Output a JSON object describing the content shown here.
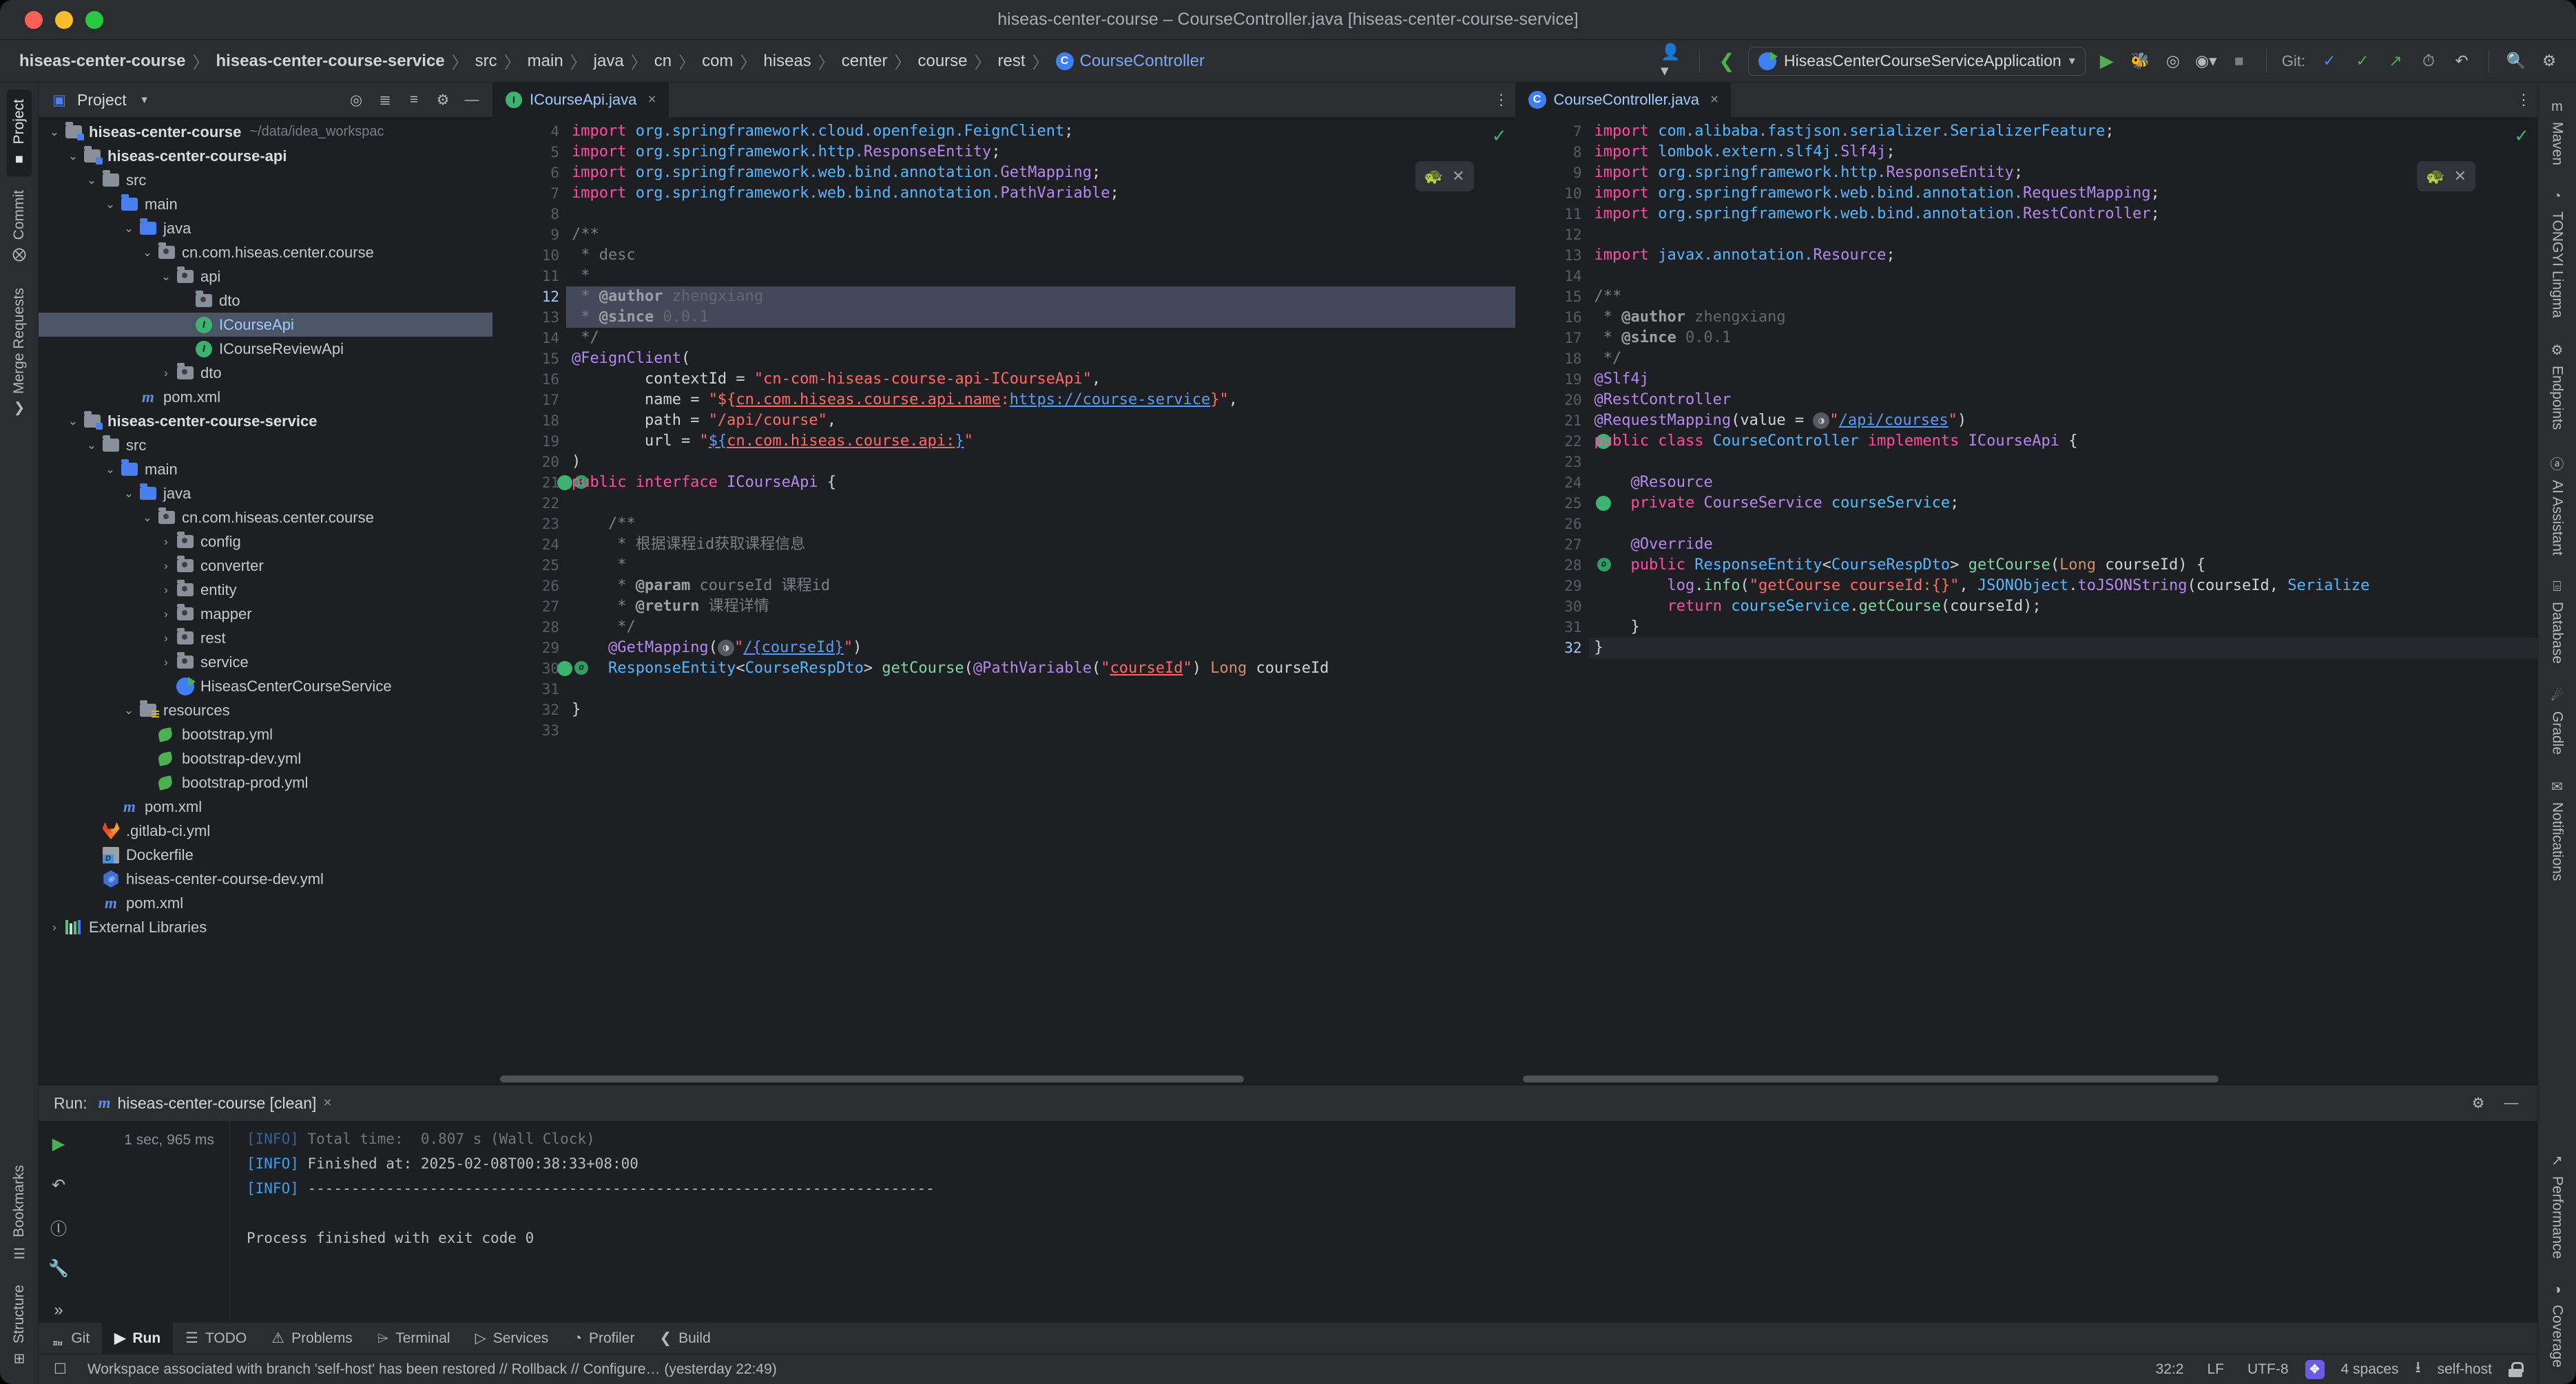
{
  "window": {
    "title": "hiseas-center-course – CourseController.java [hiseas-center-course-service]"
  },
  "breadcrumbs": [
    {
      "label": "hiseas-center-course",
      "bold": true
    },
    {
      "label": "hiseas-center-course-service",
      "bold": true
    },
    {
      "label": "src",
      "bold": false
    },
    {
      "label": "main",
      "bold": false
    },
    {
      "label": "java",
      "bold": false
    },
    {
      "label": "cn",
      "bold": false
    },
    {
      "label": "com",
      "bold": false
    },
    {
      "label": "hiseas",
      "bold": false
    },
    {
      "label": "center",
      "bold": false
    },
    {
      "label": "course",
      "bold": false
    },
    {
      "label": "rest",
      "bold": false
    },
    {
      "label": "CourseController",
      "bold": false,
      "class": true,
      "icon": "C"
    }
  ],
  "toolbar": {
    "run_config": "HiseasCenterCourseServiceApplication",
    "run_config_icon": "spring-boot-icon",
    "git_label": "Git:",
    "icons": [
      "user-avatar-icon",
      "back-arrow-icon",
      "run-icon",
      "debug-icon",
      "run-with-coverage-icon",
      "profile-icon",
      "stop-icon",
      "git-update-icon",
      "git-commit-icon",
      "git-push-icon",
      "history-icon",
      "rollback-icon",
      "search-icon",
      "settings-icon"
    ]
  },
  "left_strip": {
    "top": [
      {
        "label": "Project",
        "icon": "project-icon",
        "active": true
      },
      {
        "label": "Commit",
        "icon": "commit-icon",
        "active": false
      },
      {
        "label": "Merge Requests",
        "icon": "merge-requests-icon",
        "active": false
      }
    ],
    "bottom": [
      {
        "label": "Bookmarks",
        "icon": "bookmarks-icon",
        "active": false
      },
      {
        "label": "Structure",
        "icon": "structure-icon",
        "active": false
      }
    ]
  },
  "right_strip": {
    "top": [
      {
        "label": "Maven",
        "icon": "maven-icon"
      },
      {
        "label": "TONGYI Lingma",
        "icon": "tongyi-lingma-icon"
      },
      {
        "label": "Endpoints",
        "icon": "endpoints-icon"
      },
      {
        "label": "AI Assistant",
        "icon": "ai-assistant-icon"
      },
      {
        "label": "Database",
        "icon": "database-icon"
      },
      {
        "label": "Gradle",
        "icon": "gradle-icon"
      },
      {
        "label": "Notifications",
        "icon": "notifications-icon"
      }
    ],
    "bottom": [
      {
        "label": "Performance",
        "icon": "performance-icon"
      },
      {
        "label": "Coverage",
        "icon": "coverage-icon"
      }
    ]
  },
  "project_panel": {
    "title": "Project",
    "header_icons": [
      "locate-icon",
      "expand-all-icon",
      "collapse-all-icon",
      "gear-icon",
      "hide-icon"
    ],
    "tree": [
      {
        "depth": 0,
        "arrow": "v",
        "icon": "module-folder",
        "label": "hiseas-center-course",
        "bold": true,
        "path": "~/data/idea_workspac"
      },
      {
        "depth": 1,
        "arrow": "v",
        "icon": "module-folder",
        "label": "hiseas-center-course-api",
        "bold": true
      },
      {
        "depth": 2,
        "arrow": "v",
        "icon": "folder-gray",
        "label": "src"
      },
      {
        "depth": 3,
        "arrow": "v",
        "icon": "folder-blue",
        "label": "main"
      },
      {
        "depth": 4,
        "arrow": "v",
        "icon": "folder-blue",
        "label": "java"
      },
      {
        "depth": 5,
        "arrow": "v",
        "icon": "package",
        "label": "cn.com.hiseas.center.course"
      },
      {
        "depth": 6,
        "arrow": "v",
        "icon": "package",
        "label": "api"
      },
      {
        "depth": 7,
        "arrow": "",
        "icon": "package",
        "label": "dto"
      },
      {
        "depth": 7,
        "arrow": "",
        "icon": "interface",
        "label": "ICourseApi",
        "selected": true
      },
      {
        "depth": 7,
        "arrow": "",
        "icon": "interface",
        "label": "ICourseReviewApi"
      },
      {
        "depth": 6,
        "arrow": ">",
        "icon": "package",
        "label": "dto"
      },
      {
        "depth": 4,
        "arrow": "",
        "icon": "maven",
        "label": "pom.xml"
      },
      {
        "depth": 1,
        "arrow": "v",
        "icon": "module-folder",
        "label": "hiseas-center-course-service",
        "bold": true
      },
      {
        "depth": 2,
        "arrow": "v",
        "icon": "folder-gray",
        "label": "src"
      },
      {
        "depth": 3,
        "arrow": "v",
        "icon": "folder-blue",
        "label": "main"
      },
      {
        "depth": 4,
        "arrow": "v",
        "icon": "folder-blue",
        "label": "java"
      },
      {
        "depth": 5,
        "arrow": "v",
        "icon": "package",
        "label": "cn.com.hiseas.center.course"
      },
      {
        "depth": 6,
        "arrow": ">",
        "icon": "package",
        "label": "config"
      },
      {
        "depth": 6,
        "arrow": ">",
        "icon": "package",
        "label": "converter"
      },
      {
        "depth": 6,
        "arrow": ">",
        "icon": "package",
        "label": "entity"
      },
      {
        "depth": 6,
        "arrow": ">",
        "icon": "package",
        "label": "mapper"
      },
      {
        "depth": 6,
        "arrow": ">",
        "icon": "package",
        "label": "rest"
      },
      {
        "depth": 6,
        "arrow": ">",
        "icon": "package",
        "label": "service"
      },
      {
        "depth": 6,
        "arrow": "",
        "icon": "springboot",
        "label": "HiseasCenterCourseService"
      },
      {
        "depth": 4,
        "arrow": "v",
        "icon": "folder-resources",
        "label": "resources"
      },
      {
        "depth": 5,
        "arrow": "",
        "icon": "yaml",
        "label": "bootstrap.yml"
      },
      {
        "depth": 5,
        "arrow": "",
        "icon": "yaml",
        "label": "bootstrap-dev.yml"
      },
      {
        "depth": 5,
        "arrow": "",
        "icon": "yaml",
        "label": "bootstrap-prod.yml"
      },
      {
        "depth": 3,
        "arrow": "",
        "icon": "maven",
        "label": "pom.xml"
      },
      {
        "depth": 2,
        "arrow": "",
        "icon": "gitlab",
        "label": ".gitlab-ci.yml"
      },
      {
        "depth": 2,
        "arrow": "",
        "icon": "docker",
        "label": "Dockerfile"
      },
      {
        "depth": 2,
        "arrow": "",
        "icon": "k8s",
        "label": "hiseas-center-course-dev.yml"
      },
      {
        "depth": 2,
        "arrow": "",
        "icon": "maven",
        "label": "pom.xml"
      },
      {
        "depth": 0,
        "arrow": ">",
        "icon": "libraries",
        "label": "External Libraries"
      }
    ]
  },
  "editor_left": {
    "tab": {
      "label": "ICourseApi.java",
      "icon": "interface-icon",
      "close": "×"
    },
    "first_line_number": 4,
    "current_line": 12,
    "lines": [
      {
        "n": 4,
        "html": "<span class='kw2'>import</span> <span class='typ'>org.springframework.cloud.openfeign.FeignClient</span><span class='pln'>;</span>",
        "clipped": true
      },
      {
        "n": 5,
        "html": "<span class='kw2'>import</span> <span class='typ'>org.springframework.http.</span><span class='anno'>ResponseEntity</span><span class='pln'>;</span>"
      },
      {
        "n": 6,
        "html": "<span class='kw2'>import</span> <span class='typ'>org.springframework.web.bind.annotation.</span><span class='anno'>GetMapping</span><span class='pln'>;</span>"
      },
      {
        "n": 7,
        "html": "<span class='kw2'>import</span> <span class='typ'>org.springframework.web.bind.annotation.</span><span class='anno'>PathVariable</span><span class='pln'>;</span>",
        "fold": true
      },
      {
        "n": 8,
        "html": ""
      },
      {
        "n": 9,
        "html": "<span class='cmt'>/**</span>",
        "fold": true
      },
      {
        "n": 10,
        "html": "<span class='cmt'> * desc</span>"
      },
      {
        "n": 11,
        "html": "<span class='cmt'> *</span>"
      },
      {
        "n": 12,
        "html": "<span class='cmt'> * </span><span class='cmttag'>@author</span><span class='cmtval'> zhengxiang</span>",
        "hl": true
      },
      {
        "n": 13,
        "html": "<span class='cmt'> * </span><span class='cmttag'>@since</span><span class='cmtval'> 0.0.1</span>",
        "hl": true
      },
      {
        "n": 14,
        "html": "<span class='cmt'> */</span>",
        "fold": true
      },
      {
        "n": 15,
        "html": "<span class='anno'>@FeignClient</span><span class='pln'>(</span>",
        "fold": true
      },
      {
        "n": 16,
        "html": "        <span class='pln'>contextId = </span><span class='str'>\"cn-com-hiseas-course-api-ICourseApi\"</span><span class='pln'>,</span>"
      },
      {
        "n": 17,
        "html": "        <span class='pln'>name = </span><span class='str'>\"${</span><span class='ulred'>cn.com.hiseas.course.api.name</span><span class='str'>:</span><span class='ulink'>https://course-service</span><span class='str'>}\"</span><span class='pln'>,</span>"
      },
      {
        "n": 18,
        "html": "        <span class='pln'>path = </span><span class='str'>\"/api/course\"</span><span class='pln'>,</span>"
      },
      {
        "n": 19,
        "html": "        <span class='pln'>url = </span><span class='str'>\"</span><span class='ulink'>${</span><span class='ulred'>cn.com.hiseas.course.api:</span><span class='ulink'>}</span><span class='str'>\"</span>"
      },
      {
        "n": 20,
        "html": "<span class='pln'>)</span>",
        "fold": true
      },
      {
        "n": 21,
        "html": "<span class='kw2'>public interface</span> <span class='anno'>ICourseApi</span> <span class='pln'>{</span>",
        "gutter": "bulbs"
      },
      {
        "n": 22,
        "html": ""
      },
      {
        "n": 23,
        "html": "    <span class='cmt'>/**</span>",
        "fold": true
      },
      {
        "n": 24,
        "html": "     <span class='cmt'>* 根据课程id获取课程信息</span>"
      },
      {
        "n": 25,
        "html": "     <span class='cmt'>*</span>"
      },
      {
        "n": 26,
        "html": "     <span class='cmt'>* </span><span class='cmttag'>@param</span><span class='cmt'> courseId 课程id</span>"
      },
      {
        "n": 27,
        "html": "     <span class='cmt'>* </span><span class='cmttag'>@return</span><span class='cmt'> 课程详情</span>"
      },
      {
        "n": 28,
        "html": "     <span class='cmt'>*/</span>",
        "fold": true
      },
      {
        "n": 29,
        "html": "    <span class='anno'>@GetMapping</span><span class='pln'>(</span><span class='globe'>◑</span><span class='str'>\"</span><span class='ulink'>/{courseId}</span><span class='str'>\"</span><span class='pln'>)</span>"
      },
      {
        "n": 30,
        "html": "    <span class='typ'>ResponseEntity</span><span class='pln'>&lt;</span><span class='typ'>CourseRespDto</span><span class='pln'>&gt; </span><span class='mth'>getCourse</span><span class='pln'>(</span><span class='anno'>@PathVariable</span><span class='pln'>(</span><span class='str'>\"</span><span class='ulwav'>courseId</span><span class='str'>\"</span><span class='pln'>) </span><span class='kw'>Long</span> <span class='pln'>courseId</span>",
        "gutter": "bulbs"
      },
      {
        "n": 31,
        "html": ""
      },
      {
        "n": 32,
        "html": "<span class='pln'>}</span>"
      },
      {
        "n": 33,
        "html": ""
      }
    ]
  },
  "editor_right": {
    "tab": {
      "label": "CourseController.java",
      "icon": "class-icon",
      "close": "×"
    },
    "current_line": 32,
    "lines": [
      {
        "n": 7,
        "html": "<span class='kw2'>import</span> <span class='typ'>com.alibaba.fastjson.serializer.SerializerFeature</span><span class='pln'>;</span>",
        "clipped": true
      },
      {
        "n": 8,
        "html": "<span class='kw2'>import</span> <span class='typ'>lombok.extern.slf4j.</span><span class='anno'>Slf4j</span><span class='pln'>;</span>"
      },
      {
        "n": 9,
        "html": "<span class='kw2'>import</span> <span class='typ'>org.springframework.http.</span><span class='anno'>ResponseEntity</span><span class='pln'>;</span>"
      },
      {
        "n": 10,
        "html": "<span class='kw2'>import</span> <span class='typ'>org.springframework.web.bind.annotation.</span><span class='anno'>RequestMapping</span><span class='pln'>;</span>"
      },
      {
        "n": 11,
        "html": "<span class='kw2'>import</span> <span class='typ'>org.springframework.web.bind.annotation.</span><span class='anno'>RestController</span><span class='pln'>;</span>"
      },
      {
        "n": 12,
        "html": ""
      },
      {
        "n": 13,
        "html": "<span class='kw2'>import</span> <span class='typ'>javax.annotation.</span><span class='anno'>Resource</span><span class='pln'>;</span>",
        "fold": true
      },
      {
        "n": 14,
        "html": ""
      },
      {
        "n": 15,
        "html": "<span class='cmt'>/**</span>",
        "fold": true
      },
      {
        "n": 16,
        "html": "<span class='cmt'> * </span><span class='cmttag'>@author</span><span class='cmtval'> zhengxiang</span>"
      },
      {
        "n": 17,
        "html": "<span class='cmt'> * </span><span class='cmttag'>@since</span><span class='cmtval'> 0.0.1</span>"
      },
      {
        "n": 18,
        "html": "<span class='cmt'> */</span>",
        "fold": true
      },
      {
        "n": 19,
        "html": "<span class='anno'>@Slf4j</span>",
        "fold": true
      },
      {
        "n": 20,
        "html": "<span class='anno'>@RestController</span>"
      },
      {
        "n": 21,
        "html": "<span class='anno'>@RequestMapping</span><span class='pln'>(value = </span><span class='globe'>◑</span><span class='str'>\"</span><span class='ulink'>/api/courses</span><span class='str'>\"</span><span class='pln'>)</span>",
        "fold": true
      },
      {
        "n": 22,
        "html": "<span class='kw2'>public class</span> <span class='typ'>CourseController</span> <span class='kw2'>implements</span> <span class='anno'>ICourseApi</span> <span class='pln'>{</span>",
        "gutter": "bulb"
      },
      {
        "n": 23,
        "html": ""
      },
      {
        "n": 24,
        "html": "    <span class='anno'>@Resource</span>"
      },
      {
        "n": 25,
        "html": "    <span class='kw2'>private</span> <span class='anno'>CourseService</span> <span class='fld2'>courseService</span><span class='pln'>;</span>",
        "gutter": "bulb"
      },
      {
        "n": 26,
        "html": ""
      },
      {
        "n": 27,
        "html": "    <span class='anno'>@Override</span>"
      },
      {
        "n": 28,
        "html": "    <span class='kw2'>public</span> <span class='typ'>ResponseEntity</span><span class='pln'>&lt;</span><span class='typ'>CourseRespDto</span><span class='pln'>&gt; </span><span class='mth'>getCourse</span><span class='pln'>(</span><span class='kw'>Long</span> <span class='pln'>courseId) {</span>",
        "gutter": "impl"
      },
      {
        "n": 29,
        "html": "        <span class='anno'>log</span><span class='pln'>.</span><span class='mth'>info</span><span class='pln'>(</span><span class='str'>\"getCourse courseId:{}\"</span><span class='pln'>, </span><span class='typ'>JSONObject</span><span class='pln'>.</span><span class='anno'>toJSONString</span><span class='pln'>(courseId, </span><span class='typ'>Serialize</span>"
      },
      {
        "n": 30,
        "html": "        <span class='kw2'>return</span> <span class='fld2'>courseService</span><span class='pln'>.</span><span class='mth'>getCourse</span><span class='pln'>(</span><span class='pln'>courseId);</span>"
      },
      {
        "n": 31,
        "html": "    <span class='pln'>}</span>",
        "fold": true
      },
      {
        "n": 32,
        "html": "<span class='pln'>}</span>",
        "cur": true
      }
    ]
  },
  "run_panel": {
    "label": "Run:",
    "tab_name": "hiseas-center-course [clean]",
    "tab_icon": "maven-icon",
    "close": "×",
    "elapsed": "1 sec, 965 ms",
    "side_icons": [
      "rerun-icon",
      "rerun-failed-icon",
      "stop-icon",
      "settings-wrench-icon",
      "expand-icon"
    ],
    "console": [
      {
        "text": "[INFO] Total time:  0.807 s (Wall Clock)",
        "clipped": true
      },
      {
        "text": "[INFO] Finished at: 2025-02-08T00:38:33+08:00"
      },
      {
        "text": "[INFO] ------------------------------------------------------------------------"
      },
      {
        "text": ""
      },
      {
        "text": "Process finished with exit code 0"
      }
    ]
  },
  "bottom_bar": {
    "tabs": [
      {
        "label": "Git",
        "icon": "git-branch-icon",
        "active": false
      },
      {
        "label": "Run",
        "icon": "run-icon",
        "active": true
      },
      {
        "label": "TODO",
        "icon": "todo-list-icon",
        "active": false
      },
      {
        "label": "Problems",
        "icon": "problems-icon",
        "active": false
      },
      {
        "label": "Terminal",
        "icon": "terminal-icon",
        "active": false
      },
      {
        "label": "Services",
        "icon": "services-icon",
        "active": false
      },
      {
        "label": "Profiler",
        "icon": "profiler-icon",
        "active": false
      },
      {
        "label": "Build",
        "icon": "build-icon",
        "active": false
      }
    ]
  },
  "status_bar": {
    "message": "Workspace associated with branch 'self-host' has been restored // Rollback // Configure… (yesterday 22:49)",
    "caret": "32:2",
    "line_separator": "LF",
    "encoding": "UTF-8",
    "indent": "4 spaces",
    "branch": "self-host",
    "branch_icon": "git-branch-icon",
    "lock_icon": "unlocked-icon",
    "tool_icon": "wakatime-icon"
  }
}
